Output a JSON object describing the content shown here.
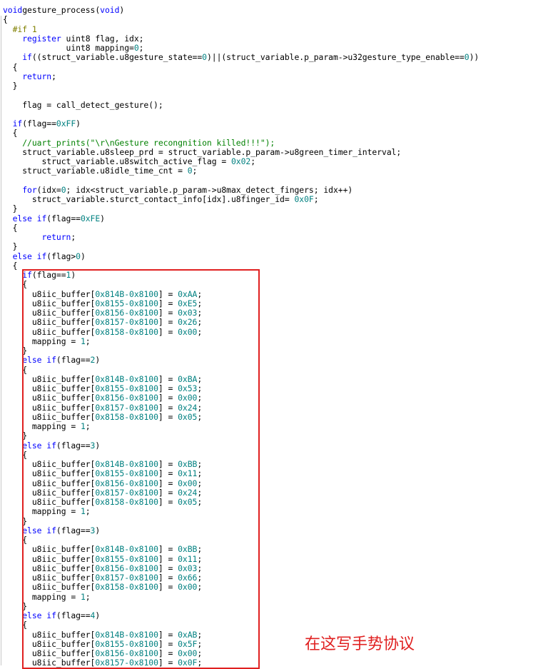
{
  "editor": {
    "lines": [
      {
        "indent": 0,
        "tokens": [
          [
            "kw",
            "void"
          ],
          [
            "",
            "gesture_process("
          ],
          [
            "kw",
            "void"
          ],
          [
            "",
            ")"
          ]
        ]
      },
      {
        "indent": 0,
        "tokens": [
          [
            "",
            "{"
          ]
        ]
      },
      {
        "indent": 2,
        "tokens": [
          [
            "pre",
            "#if 1"
          ]
        ]
      },
      {
        "indent": 4,
        "tokens": [
          [
            "kw",
            "register"
          ],
          [
            "",
            " uint8 flag, idx;"
          ]
        ]
      },
      {
        "indent": 13,
        "tokens": [
          [
            "",
            "uint8 mapping="
          ],
          [
            "num",
            "0"
          ],
          [
            "",
            ";"
          ]
        ]
      },
      {
        "indent": 4,
        "tokens": [
          [
            "kw",
            "if"
          ],
          [
            "",
            "((struct_variable.u8gesture_state=="
          ],
          [
            "num",
            "0"
          ],
          [
            "",
            ")||(struct_variable.p_param->u32gesture_type_enable=="
          ],
          [
            "num",
            "0"
          ],
          [
            "",
            "))"
          ]
        ]
      },
      {
        "indent": 2,
        "tokens": [
          [
            "",
            "{"
          ]
        ]
      },
      {
        "indent": 4,
        "tokens": [
          [
            "kw",
            "return"
          ],
          [
            "",
            ";"
          ]
        ]
      },
      {
        "indent": 2,
        "tokens": [
          [
            "",
            "}"
          ]
        ]
      },
      {
        "indent": 0,
        "tokens": []
      },
      {
        "indent": 4,
        "tokens": [
          [
            "",
            "flag = call_detect_gesture();"
          ]
        ]
      },
      {
        "indent": 0,
        "tokens": []
      },
      {
        "indent": 2,
        "tokens": [
          [
            "kw",
            "if"
          ],
          [
            "",
            "(flag=="
          ],
          [
            "num",
            "0xFF"
          ],
          [
            "",
            ")"
          ]
        ]
      },
      {
        "indent": 2,
        "tokens": [
          [
            "",
            "{"
          ]
        ]
      },
      {
        "indent": 4,
        "tokens": [
          [
            "com",
            "//uart_prints(\"\\r\\nGesture recongnition killed!!!\");"
          ]
        ]
      },
      {
        "indent": 4,
        "tokens": [
          [
            "",
            "struct_variable.u8sleep_prd = struct_variable.p_param->u8green_timer_interval;"
          ]
        ]
      },
      {
        "indent": 8,
        "tokens": [
          [
            "",
            "struct_variable.u8switch_active_flag = "
          ],
          [
            "num",
            "0x02"
          ],
          [
            "",
            ";"
          ]
        ]
      },
      {
        "indent": 4,
        "tokens": [
          [
            "",
            "struct_variable.u8idle_time_cnt = "
          ],
          [
            "num",
            "0"
          ],
          [
            "",
            ";"
          ]
        ]
      },
      {
        "indent": 0,
        "tokens": []
      },
      {
        "indent": 4,
        "tokens": [
          [
            "kw",
            "for"
          ],
          [
            "",
            "(idx="
          ],
          [
            "num",
            "0"
          ],
          [
            "",
            "; idx<struct_variable.p_param->u8max_detect_fingers; idx++)"
          ]
        ]
      },
      {
        "indent": 6,
        "tokens": [
          [
            "",
            "struct_variable.sturct_contact_info[idx].u8finger_id= "
          ],
          [
            "num",
            "0x0F"
          ],
          [
            "",
            ";"
          ]
        ]
      },
      {
        "indent": 2,
        "tokens": [
          [
            "",
            "}"
          ]
        ]
      },
      {
        "indent": 2,
        "tokens": [
          [
            "kw",
            "else if"
          ],
          [
            "",
            "(flag=="
          ],
          [
            "num",
            "0xFE"
          ],
          [
            "",
            ")"
          ]
        ]
      },
      {
        "indent": 2,
        "tokens": [
          [
            "",
            "{"
          ]
        ]
      },
      {
        "indent": 8,
        "tokens": [
          [
            "kw",
            "return"
          ],
          [
            "",
            ";"
          ]
        ]
      },
      {
        "indent": 2,
        "tokens": [
          [
            "",
            "}"
          ]
        ]
      },
      {
        "indent": 2,
        "tokens": [
          [
            "kw",
            "else if"
          ],
          [
            "",
            "(flag>"
          ],
          [
            "num",
            "0"
          ],
          [
            "",
            ")"
          ]
        ]
      },
      {
        "indent": 2,
        "tokens": [
          [
            "",
            "{"
          ]
        ]
      },
      {
        "indent": 4,
        "tokens": [
          [
            "kw",
            "if"
          ],
          [
            "",
            "(flag=="
          ],
          [
            "num",
            "1"
          ],
          [
            "",
            ")"
          ]
        ]
      },
      {
        "indent": 4,
        "tokens": [
          [
            "",
            "{"
          ]
        ]
      },
      {
        "indent": 6,
        "tokens": [
          [
            "",
            "u8iic_buffer["
          ],
          [
            "num",
            "0x814B-0x8100"
          ],
          [
            "",
            "] = "
          ],
          [
            "num",
            "0xAA"
          ],
          [
            "",
            ";"
          ]
        ]
      },
      {
        "indent": 6,
        "tokens": [
          [
            "",
            "u8iic_buffer["
          ],
          [
            "num",
            "0x8155-0x8100"
          ],
          [
            "",
            "] = "
          ],
          [
            "num",
            "0xE5"
          ],
          [
            "",
            ";"
          ]
        ]
      },
      {
        "indent": 6,
        "tokens": [
          [
            "",
            "u8iic_buffer["
          ],
          [
            "num",
            "0x8156-0x8100"
          ],
          [
            "",
            "] = "
          ],
          [
            "num",
            "0x03"
          ],
          [
            "",
            ";"
          ]
        ]
      },
      {
        "indent": 6,
        "tokens": [
          [
            "",
            "u8iic_buffer["
          ],
          [
            "num",
            "0x8157-0x8100"
          ],
          [
            "",
            "] = "
          ],
          [
            "num",
            "0x26"
          ],
          [
            "",
            ";"
          ]
        ]
      },
      {
        "indent": 6,
        "tokens": [
          [
            "",
            "u8iic_buffer["
          ],
          [
            "num",
            "0x8158-0x8100"
          ],
          [
            "",
            "] = "
          ],
          [
            "num",
            "0x00"
          ],
          [
            "",
            ";"
          ]
        ]
      },
      {
        "indent": 6,
        "tokens": [
          [
            "",
            "mapping = "
          ],
          [
            "num",
            "1"
          ],
          [
            "",
            ";"
          ]
        ]
      },
      {
        "indent": 4,
        "tokens": [
          [
            "",
            "}"
          ]
        ]
      },
      {
        "indent": 4,
        "tokens": [
          [
            "kw",
            "else if"
          ],
          [
            "",
            "(flag=="
          ],
          [
            "num",
            "2"
          ],
          [
            "",
            ")"
          ]
        ]
      },
      {
        "indent": 4,
        "tokens": [
          [
            "",
            "{"
          ]
        ]
      },
      {
        "indent": 6,
        "tokens": [
          [
            "",
            "u8iic_buffer["
          ],
          [
            "num",
            "0x814B-0x8100"
          ],
          [
            "",
            "] = "
          ],
          [
            "num",
            "0xBA"
          ],
          [
            "",
            ";"
          ]
        ]
      },
      {
        "indent": 6,
        "tokens": [
          [
            "",
            "u8iic_buffer["
          ],
          [
            "num",
            "0x8155-0x8100"
          ],
          [
            "",
            "] = "
          ],
          [
            "num",
            "0x53"
          ],
          [
            "",
            ";"
          ]
        ]
      },
      {
        "indent": 6,
        "tokens": [
          [
            "",
            "u8iic_buffer["
          ],
          [
            "num",
            "0x8156-0x8100"
          ],
          [
            "",
            "] = "
          ],
          [
            "num",
            "0x00"
          ],
          [
            "",
            ";"
          ]
        ]
      },
      {
        "indent": 6,
        "tokens": [
          [
            "",
            "u8iic_buffer["
          ],
          [
            "num",
            "0x8157-0x8100"
          ],
          [
            "",
            "] = "
          ],
          [
            "num",
            "0x24"
          ],
          [
            "",
            ";"
          ]
        ]
      },
      {
        "indent": 6,
        "tokens": [
          [
            "",
            "u8iic_buffer["
          ],
          [
            "num",
            "0x8158-0x8100"
          ],
          [
            "",
            "] = "
          ],
          [
            "num",
            "0x05"
          ],
          [
            "",
            ";"
          ]
        ]
      },
      {
        "indent": 6,
        "tokens": [
          [
            "",
            "mapping = "
          ],
          [
            "num",
            "1"
          ],
          [
            "",
            ";"
          ]
        ]
      },
      {
        "indent": 4,
        "tokens": [
          [
            "",
            "}"
          ]
        ]
      },
      {
        "indent": 4,
        "tokens": [
          [
            "kw",
            "else if"
          ],
          [
            "",
            "(flag=="
          ],
          [
            "num",
            "3"
          ],
          [
            "",
            ")"
          ]
        ]
      },
      {
        "indent": 4,
        "tokens": [
          [
            "",
            "{"
          ]
        ]
      },
      {
        "indent": 6,
        "tokens": [
          [
            "",
            "u8iic_buffer["
          ],
          [
            "num",
            "0x814B-0x8100"
          ],
          [
            "",
            "] = "
          ],
          [
            "num",
            "0xBB"
          ],
          [
            "",
            ";"
          ]
        ]
      },
      {
        "indent": 6,
        "tokens": [
          [
            "",
            "u8iic_buffer["
          ],
          [
            "num",
            "0x8155-0x8100"
          ],
          [
            "",
            "] = "
          ],
          [
            "num",
            "0x11"
          ],
          [
            "",
            ";"
          ]
        ]
      },
      {
        "indent": 6,
        "tokens": [
          [
            "",
            "u8iic_buffer["
          ],
          [
            "num",
            "0x8156-0x8100"
          ],
          [
            "",
            "] = "
          ],
          [
            "num",
            "0x00"
          ],
          [
            "",
            ";"
          ]
        ]
      },
      {
        "indent": 6,
        "tokens": [
          [
            "",
            "u8iic_buffer["
          ],
          [
            "num",
            "0x8157-0x8100"
          ],
          [
            "",
            "] = "
          ],
          [
            "num",
            "0x24"
          ],
          [
            "",
            ";"
          ]
        ]
      },
      {
        "indent": 6,
        "tokens": [
          [
            "",
            "u8iic_buffer["
          ],
          [
            "num",
            "0x8158-0x8100"
          ],
          [
            "",
            "] = "
          ],
          [
            "num",
            "0x05"
          ],
          [
            "",
            ";"
          ]
        ]
      },
      {
        "indent": 6,
        "tokens": [
          [
            "",
            "mapping = "
          ],
          [
            "num",
            "1"
          ],
          [
            "",
            ";"
          ]
        ]
      },
      {
        "indent": 4,
        "tokens": [
          [
            "",
            "}"
          ]
        ]
      },
      {
        "indent": 4,
        "tokens": [
          [
            "kw",
            "else if"
          ],
          [
            "",
            "(flag=="
          ],
          [
            "num",
            "3"
          ],
          [
            "",
            ")"
          ]
        ]
      },
      {
        "indent": 4,
        "tokens": [
          [
            "",
            "{"
          ]
        ]
      },
      {
        "indent": 6,
        "tokens": [
          [
            "",
            "u8iic_buffer["
          ],
          [
            "num",
            "0x814B-0x8100"
          ],
          [
            "",
            "] = "
          ],
          [
            "num",
            "0xBB"
          ],
          [
            "",
            ";"
          ]
        ]
      },
      {
        "indent": 6,
        "tokens": [
          [
            "",
            "u8iic_buffer["
          ],
          [
            "num",
            "0x8155-0x8100"
          ],
          [
            "",
            "] = "
          ],
          [
            "num",
            "0x11"
          ],
          [
            "",
            ";"
          ]
        ]
      },
      {
        "indent": 6,
        "tokens": [
          [
            "",
            "u8iic_buffer["
          ],
          [
            "num",
            "0x8156-0x8100"
          ],
          [
            "",
            "] = "
          ],
          [
            "num",
            "0x03"
          ],
          [
            "",
            ";"
          ]
        ]
      },
      {
        "indent": 6,
        "tokens": [
          [
            "",
            "u8iic_buffer["
          ],
          [
            "num",
            "0x8157-0x8100"
          ],
          [
            "",
            "] = "
          ],
          [
            "num",
            "0x66"
          ],
          [
            "",
            ";"
          ]
        ]
      },
      {
        "indent": 6,
        "tokens": [
          [
            "",
            "u8iic_buffer["
          ],
          [
            "num",
            "0x8158-0x8100"
          ],
          [
            "",
            "] = "
          ],
          [
            "num",
            "0x00"
          ],
          [
            "",
            ";"
          ]
        ]
      },
      {
        "indent": 6,
        "tokens": [
          [
            "",
            "mapping = "
          ],
          [
            "num",
            "1"
          ],
          [
            "",
            ";"
          ]
        ]
      },
      {
        "indent": 4,
        "tokens": [
          [
            "",
            "}"
          ]
        ]
      },
      {
        "indent": 4,
        "tokens": [
          [
            "kw",
            "else if"
          ],
          [
            "",
            "(flag=="
          ],
          [
            "num",
            "4"
          ],
          [
            "",
            ")"
          ]
        ]
      },
      {
        "indent": 4,
        "tokens": [
          [
            "",
            "{"
          ]
        ]
      },
      {
        "indent": 6,
        "tokens": [
          [
            "",
            "u8iic_buffer["
          ],
          [
            "num",
            "0x814B-0x8100"
          ],
          [
            "",
            "] = "
          ],
          [
            "num",
            "0xAB"
          ],
          [
            "",
            ";"
          ]
        ]
      },
      {
        "indent": 6,
        "tokens": [
          [
            "",
            "u8iic_buffer["
          ],
          [
            "num",
            "0x8155-0x8100"
          ],
          [
            "",
            "] = "
          ],
          [
            "num",
            "0x5F"
          ],
          [
            "",
            ";"
          ]
        ]
      },
      {
        "indent": 6,
        "tokens": [
          [
            "",
            "u8iic_buffer["
          ],
          [
            "num",
            "0x8156-0x8100"
          ],
          [
            "",
            "] = "
          ],
          [
            "num",
            "0x00"
          ],
          [
            "",
            ";"
          ]
        ]
      },
      {
        "indent": 6,
        "tokens": [
          [
            "",
            "u8iic_buffer["
          ],
          [
            "num",
            "0x8157-0x8100"
          ],
          [
            "",
            "] = "
          ],
          [
            "num",
            "0x0F"
          ],
          [
            "",
            ";"
          ]
        ]
      }
    ]
  },
  "annotation": {
    "text": "在这写手势协议",
    "color": "#e02020"
  },
  "colors": {
    "keyword": "#0000ff",
    "number": "#008080",
    "comment": "#008000",
    "preprocessor": "#808000",
    "highlight_border": "#e02020"
  }
}
